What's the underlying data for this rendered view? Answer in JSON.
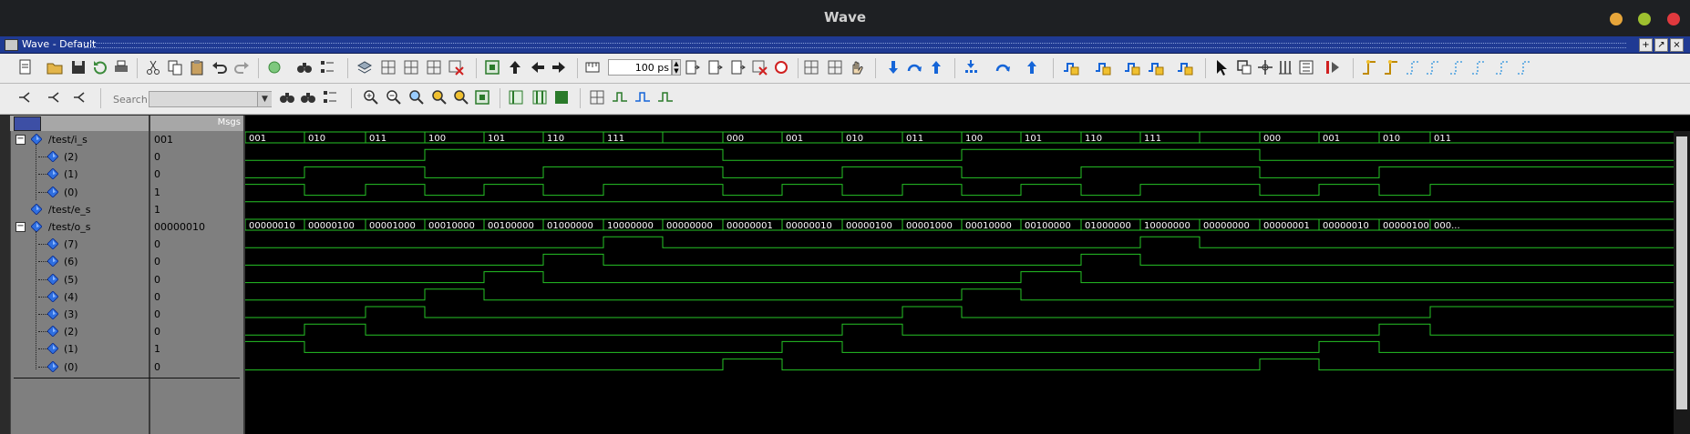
{
  "window": {
    "title": "Wave",
    "subtitle": "Wave - Default"
  },
  "toolbar": {
    "zoom_value": "100 ps",
    "search_label": "Search:",
    "search_value": ""
  },
  "headers": {
    "msgs": "Msgs"
  },
  "signals": [
    {
      "name": "/test/i_s",
      "value": "001",
      "expand": "−",
      "indent": 0
    },
    {
      "name": "(2)",
      "value": "0",
      "indent": 1
    },
    {
      "name": "(1)",
      "value": "0",
      "indent": 1
    },
    {
      "name": "(0)",
      "value": "1",
      "indent": 1
    },
    {
      "name": "/test/e_s",
      "value": "1",
      "indent": 0,
      "leaf": true
    },
    {
      "name": "/test/o_s",
      "value": "00000010",
      "expand": "−",
      "indent": 0
    },
    {
      "name": "(7)",
      "value": "0",
      "indent": 1
    },
    {
      "name": "(6)",
      "value": "0",
      "indent": 1
    },
    {
      "name": "(5)",
      "value": "0",
      "indent": 1
    },
    {
      "name": "(4)",
      "value": "0",
      "indent": 1
    },
    {
      "name": "(3)",
      "value": "0",
      "indent": 1
    },
    {
      "name": "(2)",
      "value": "0",
      "indent": 1
    },
    {
      "name": "(1)",
      "value": "1",
      "indent": 1
    },
    {
      "name": "(0)",
      "value": "0",
      "indent": 1
    }
  ],
  "waveform": {
    "segment_boundaries": [
      0,
      65,
      132,
      197,
      262,
      327,
      393,
      458,
      524,
      589,
      655,
      721,
      786,
      851,
      917,
      982,
      1047,
      1113,
      1178,
      1244,
      1300
    ],
    "i_s_labels": [
      "001",
      "010",
      "011",
      "100",
      "101",
      "110",
      "111",
      "",
      "000",
      "001",
      "010",
      "011",
      "100",
      "101",
      "110",
      "111",
      "",
      "000",
      "001",
      "010",
      "011"
    ],
    "i_s_bits": [
      1,
      2,
      3,
      4,
      5,
      6,
      7,
      7,
      0,
      1,
      2,
      3,
      4,
      5,
      6,
      7,
      7,
      0,
      1,
      2,
      3
    ],
    "o_s_labels": [
      "00000010",
      "00000100",
      "00001000",
      "00010000",
      "00100000",
      "01000000",
      "10000000",
      "00000000",
      "00000001",
      "00000010",
      "00000100",
      "00001000",
      "00010000",
      "00100000",
      "01000000",
      "10000000",
      "00000000",
      "00000001",
      "00000010",
      "00000100",
      "000..."
    ],
    "o_s_bytes": [
      2,
      4,
      8,
      16,
      32,
      64,
      128,
      0,
      1,
      2,
      4,
      8,
      16,
      32,
      64,
      128,
      0,
      1,
      2,
      4,
      8
    ],
    "e_s_level": 1
  },
  "colors": {
    "wave": "#26c326",
    "bg": "#000000",
    "panel": "#7f7f7f",
    "accent": "#1f3a93",
    "diamond": "#2f6fe0"
  }
}
